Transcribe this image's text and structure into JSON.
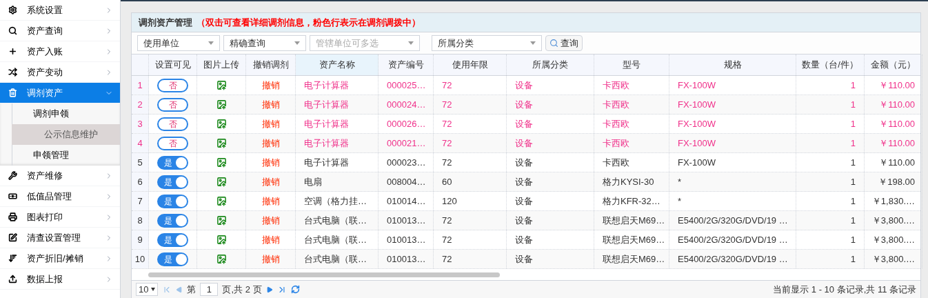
{
  "sidebar": {
    "items": [
      {
        "label": "系统设置",
        "expanded": false,
        "selected": false
      },
      {
        "label": "资产查询",
        "expanded": false,
        "selected": false
      },
      {
        "label": "资产入账",
        "expanded": false,
        "selected": false
      },
      {
        "label": "资产变动",
        "expanded": false,
        "selected": false
      },
      {
        "label": "调剂资产",
        "expanded": true,
        "selected": true,
        "children": [
          {
            "label": "调剂申领",
            "selected": false
          },
          {
            "label": "公示信息维护",
            "selected": true
          },
          {
            "label": "申领管理",
            "selected": false
          }
        ]
      },
      {
        "label": "资产维修",
        "expanded": false,
        "selected": false
      },
      {
        "label": "低值品管理",
        "expanded": false,
        "selected": false
      },
      {
        "label": "图表打印",
        "expanded": false,
        "selected": false
      },
      {
        "label": "清查设置管理",
        "expanded": false,
        "selected": false
      },
      {
        "label": "资产折旧/摊销",
        "expanded": false,
        "selected": false
      },
      {
        "label": "数据上报",
        "expanded": false,
        "selected": false
      }
    ]
  },
  "panel": {
    "title": "调剂资产管理",
    "note": "（双击可查看详细调剂信息，粉色行表示在调剂调拨中）",
    "filters": [
      {
        "value": "使用单位"
      },
      {
        "value": "精确查询"
      },
      {
        "placeholder": "管辖单位可多选"
      },
      {
        "value": "所属分类"
      }
    ],
    "search_button": "查询",
    "table": {
      "columns": [
        "设置可见",
        "图片上传",
        "撤销调剂",
        "资产名称",
        "资产编号",
        "使用年限",
        "所属分类",
        "型号",
        "规格",
        "数量（台/件）",
        "金额（元）"
      ],
      "rows": [
        {
          "index": "1",
          "in_transfer": true,
          "visible": false,
          "toggle": "否",
          "revoke": "撤销",
          "name": "电子计算器",
          "code": "000025…",
          "years": "72",
          "category": "设备",
          "model": "卡西欧",
          "spec": "FX-100W",
          "qty": "1",
          "amount": "￥110.00"
        },
        {
          "index": "2",
          "in_transfer": true,
          "visible": false,
          "toggle": "否",
          "revoke": "撤销",
          "name": "电子计算器",
          "code": "000024…",
          "years": "72",
          "category": "设备",
          "model": "卡西欧",
          "spec": "FX-100W",
          "qty": "1",
          "amount": "￥110.00"
        },
        {
          "index": "3",
          "in_transfer": true,
          "visible": false,
          "toggle": "否",
          "revoke": "撤销",
          "name": "电子计算器",
          "code": "000026…",
          "years": "72",
          "category": "设备",
          "model": "卡西欧",
          "spec": "FX-100W",
          "qty": "1",
          "amount": "￥110.00"
        },
        {
          "index": "4",
          "in_transfer": true,
          "visible": false,
          "toggle": "否",
          "revoke": "撤销",
          "name": "电子计算器",
          "code": "000021…",
          "years": "72",
          "category": "设备",
          "model": "卡西欧",
          "spec": "FX-100W",
          "qty": "1",
          "amount": "￥110.00"
        },
        {
          "index": "5",
          "in_transfer": false,
          "visible": true,
          "toggle": "是",
          "revoke": "撤销",
          "name": "电子计算器",
          "code": "000023…",
          "years": "72",
          "category": "设备",
          "model": "卡西欧",
          "spec": "FX-100W",
          "qty": "1",
          "amount": "￥110.00"
        },
        {
          "index": "6",
          "in_transfer": false,
          "visible": true,
          "toggle": "是",
          "revoke": "撤销",
          "name": "电扇",
          "code": "008004…",
          "years": "60",
          "category": "设备",
          "model": "格力KYSI-30",
          "spec": "*",
          "qty": "1",
          "amount": "￥198.00"
        },
        {
          "index": "7",
          "in_transfer": false,
          "visible": true,
          "toggle": "是",
          "revoke": "撤销",
          "name": "空调（格力挂…",
          "code": "010014…",
          "years": "120",
          "category": "设备",
          "model": "格力KFR-32…",
          "spec": "*",
          "qty": "1",
          "amount": "￥1,830.…"
        },
        {
          "index": "8",
          "in_transfer": false,
          "visible": true,
          "toggle": "是",
          "revoke": "撤销",
          "name": "台式电脑（联…",
          "code": "010013…",
          "years": "72",
          "category": "设备",
          "model": "联想启天M69…",
          "spec": "E5400/2G/320G/DVD/19 …",
          "qty": "1",
          "amount": "￥3,800.…"
        },
        {
          "index": "9",
          "in_transfer": false,
          "visible": true,
          "toggle": "是",
          "revoke": "撤销",
          "name": "台式电脑（联…",
          "code": "010013…",
          "years": "72",
          "category": "设备",
          "model": "联想启天M69…",
          "spec": "E5400/2G/320G/DVD/19 …",
          "qty": "1",
          "amount": "￥3,800.…"
        },
        {
          "index": "10",
          "in_transfer": false,
          "visible": true,
          "toggle": "是",
          "revoke": "撤销",
          "name": "台式电脑（联…",
          "code": "010013…",
          "years": "72",
          "category": "设备",
          "model": "联想启天M69…",
          "spec": "E5400/2G/320G/DVD/19 …",
          "qty": "1",
          "amount": "￥3,800.…"
        }
      ]
    },
    "pager": {
      "page_size": "10",
      "page_prefix": "第",
      "page": "1",
      "page_suffix": "页,共 2 页",
      "summary": "当前显示 1 - 10 条记录,共 11 条记录"
    }
  }
}
